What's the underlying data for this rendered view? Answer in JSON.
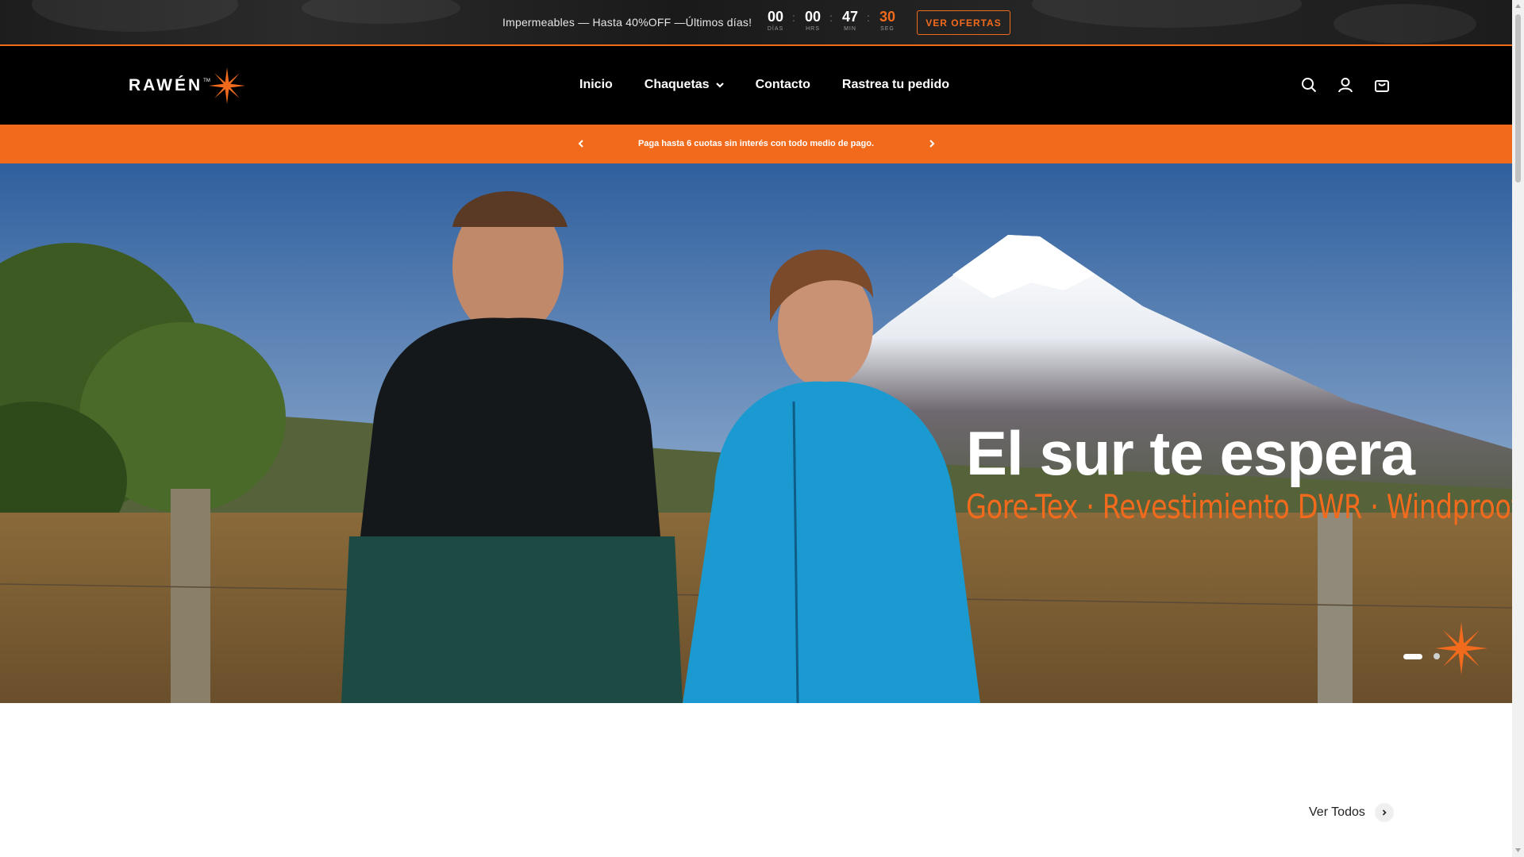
{
  "promo": {
    "text": "Impermeables — Hasta 40%OFF —Últimos días!",
    "countdown": [
      {
        "value": "00",
        "label": "DÍAS"
      },
      {
        "value": "00",
        "label": "HRS"
      },
      {
        "value": "47",
        "label": "MIN"
      },
      {
        "value": "30",
        "label": "SEG"
      }
    ],
    "separator": ":",
    "cta_label": "VER OFERTAS",
    "accent_color": "#f26b1d"
  },
  "header": {
    "logo_text": "RAWÉN",
    "logo_tm": "TM",
    "nav": [
      "Inicio",
      "Chaquetas",
      "Contacto",
      "Rastrea tu pedido"
    ],
    "icons": [
      "search-icon",
      "account-icon",
      "cart-icon"
    ]
  },
  "announcement": {
    "text": "Paga hasta 6 cuotas sin interés con todo medio de pago.",
    "background": "#f26b1d"
  },
  "hero": {
    "title": "El sur te espera",
    "subtitle": "Gore-Tex · Revestimiento DWR · Windproof",
    "slides": 2,
    "active_slide": 1
  },
  "collection": {
    "view_all_label": "Ver Todos"
  }
}
